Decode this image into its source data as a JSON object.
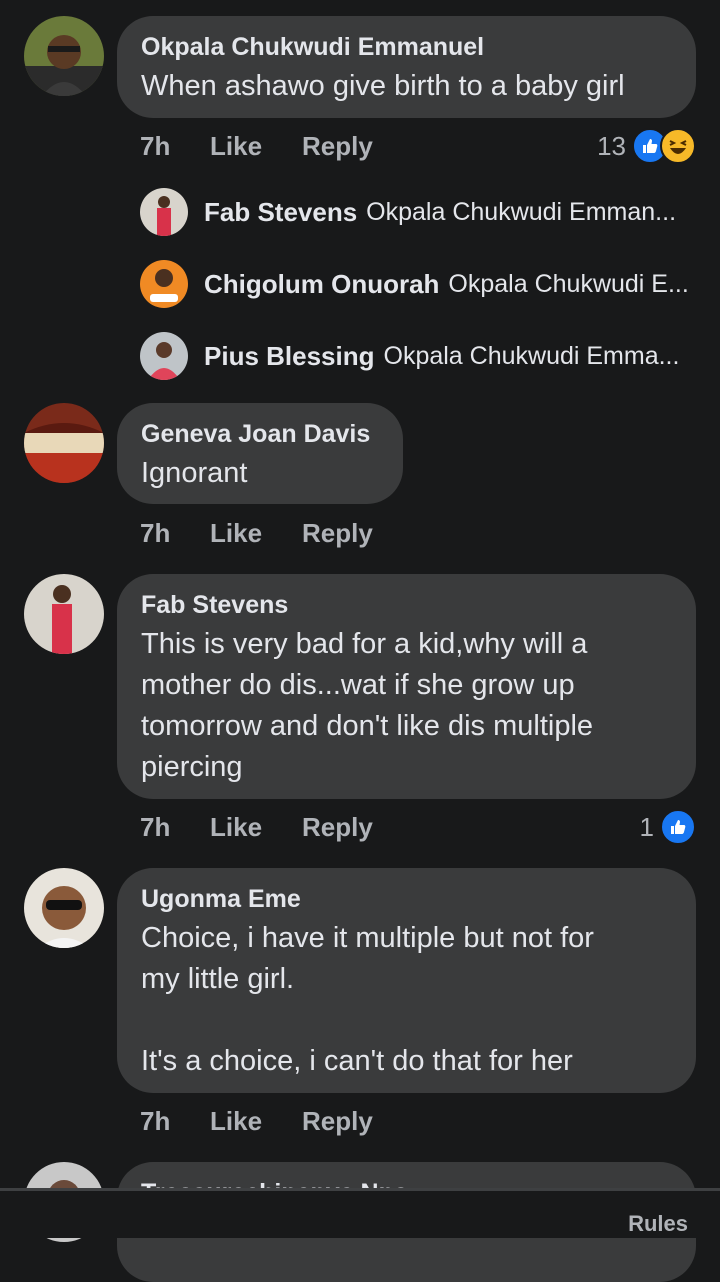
{
  "comments": [
    {
      "author": "Okpala Chukwudi Emmanuel",
      "text": "When ashawo give birth to a baby girl",
      "time": "7h",
      "like": "Like",
      "reply": "Reply",
      "reaction_count": "13",
      "reaction_icons": [
        "like-icon",
        "haha-icon"
      ],
      "replies": [
        {
          "author": "Fab Stevens",
          "text": "Okpala Chukwudi Emman..."
        },
        {
          "author": "Chigolum Onuorah",
          "text": "Okpala Chukwudi E..."
        },
        {
          "author": "Pius Blessing",
          "text": "Okpala Chukwudi Emma..."
        }
      ]
    },
    {
      "author": "Geneva Joan Davis",
      "text": "Ignorant",
      "time": "7h",
      "like": "Like",
      "reply": "Reply"
    },
    {
      "author": "Fab Stevens",
      "text": "This is very bad for a kid,why will a\nmother do dis...wat if she grow up\ntomorrow and don't like dis multiple\npiercing",
      "time": "7h",
      "like": "Like",
      "reply": "Reply",
      "reaction_count": "1",
      "reaction_icons": [
        "like-icon"
      ]
    },
    {
      "author": "Ugonma Eme",
      "text": "Choice, i have it multiple but not for\nmy little girl.\n\n It's a choice, i can't do that for her",
      "time": "7h",
      "like": "Like",
      "reply": "Reply"
    },
    {
      "author": "Treasurechinenye Nna"
    }
  ],
  "footer": {
    "rules": "Rules"
  },
  "colors": {
    "background": "#18191a",
    "bubble": "#3a3b3c",
    "like_blue": "#1877f2",
    "haha_yellow": "#f7b928"
  }
}
